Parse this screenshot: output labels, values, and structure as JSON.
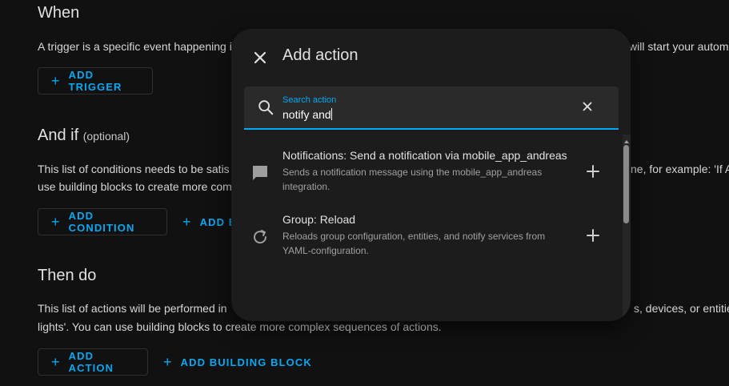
{
  "when": {
    "title": "When",
    "description": "A trigger is a specific event happening i",
    "description_right": "will start your automa",
    "add_trigger_label": "ADD TRIGGER"
  },
  "and_if": {
    "title": "And if",
    "optional": "(optional)",
    "description_line1": "This list of conditions needs to be satis",
    "description_line1_right": "ne, for example: 'If A",
    "description_line2": "use building blocks to create more com",
    "add_condition_label": "ADD CONDITION",
    "add_building_block_partial": "ADD B"
  },
  "then_do": {
    "title": "Then do",
    "description_line1": "This list of actions will be performed in",
    "description_line1_right": "s, devices, or entitie",
    "description_line2": "lights'. You can use building blocks to create more complex sequences of actions.",
    "add_action_label": "ADD ACTION",
    "add_building_block_label": "ADD BUILDING BLOCK"
  },
  "dialog": {
    "title": "Add action",
    "close_icon": "close-icon",
    "search": {
      "label": "Search action",
      "value": "notify and",
      "icon": "search-icon",
      "clear_icon": "clear-icon"
    },
    "items": [
      {
        "title": "Notifications: Send a notification via mobile_app_andreas",
        "description": "Sends a notification message using the mobile_app_andreas integration.",
        "icon": "message-icon"
      },
      {
        "title": "Group: Reload",
        "description": "Reloads group configuration, entities, and notify services from YAML-configuration.",
        "icon": "reload-icon"
      }
    ]
  },
  "colors": {
    "accent": "#03a9f4",
    "background": "#111111",
    "dialog": "#1c1c1c",
    "search_field": "#2a2a2a"
  }
}
